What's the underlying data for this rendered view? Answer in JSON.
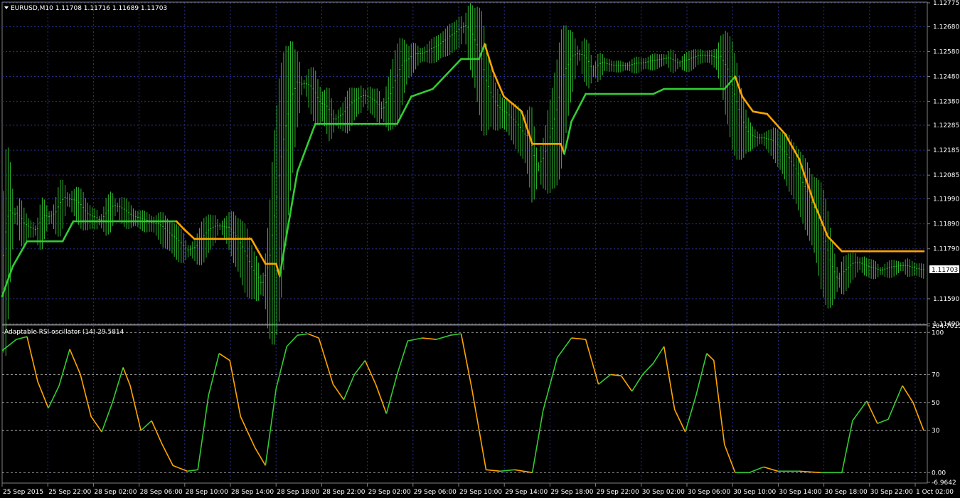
{
  "main_chart": {
    "symbol_info": "EURUSD,M10  1.11708 1.11716 1.11689 1.11703",
    "price_ticks": [
      "1.12775",
      "1.12680",
      "1.12580",
      "1.12480",
      "1.12380",
      "1.12285",
      "1.12185",
      "1.12085",
      "1.11990",
      "1.11890",
      "1.11790",
      "1.11590",
      "1.11490"
    ],
    "current_price": "1.11703",
    "colors": {
      "bars": "#32cd32",
      "ma_up": "#32cd32",
      "ma_down": "#ffa500",
      "grid": "#2a2f8a",
      "price_tag": "#ffffff"
    }
  },
  "oscillator": {
    "title": "Adaptable RSI oscillator (14) 29.5814",
    "levels": [
      "104.7015",
      "100",
      "70",
      "50",
      "30",
      "0.00",
      "-6.9642"
    ],
    "colors": {
      "up": "#32cd32",
      "down": "#ffa500"
    }
  },
  "time_axis": {
    "labels": [
      "25 Sep 2015",
      "25 Sep 22:00",
      "28 Sep 02:00",
      "28 Sep 06:00",
      "28 Sep 10:00",
      "28 Sep 14:00",
      "28 Sep 18:00",
      "28 Sep 22:00",
      "29 Sep 02:00",
      "29 Sep 06:00",
      "29 Sep 10:00",
      "29 Sep 14:00",
      "29 Sep 18:00",
      "29 Sep 22:00",
      "30 Sep 02:00",
      "30 Sep 06:00",
      "30 Sep 10:00",
      "30 Sep 14:00",
      "30 Sep 18:00",
      "30 Sep 22:00",
      "1 Oct 02:00"
    ]
  },
  "chart_data": [
    {
      "type": "line",
      "title": "EURUSD,M10",
      "ylim": [
        1.1149,
        1.12775
      ],
      "series": [
        {
          "name": "price",
          "points": [
            [
              0,
              1.1165
            ],
            [
              10,
              1.1189
            ],
            [
              20,
              1.1193
            ],
            [
              30,
              1.1188
            ],
            [
              50,
              1.1186
            ],
            [
              60,
              1.1191
            ],
            [
              75,
              1.1192
            ],
            [
              90,
              1.1199
            ],
            [
              105,
              1.1197
            ],
            [
              120,
              1.1192
            ],
            [
              140,
              1.119
            ],
            [
              160,
              1.1196
            ],
            [
              180,
              1.1192
            ],
            [
              200,
              1.119
            ],
            [
              220,
              1.1188
            ],
            [
              240,
              1.1183
            ],
            [
              260,
              1.1178
            ],
            [
              275,
              1.1179
            ],
            [
              290,
              1.1185
            ],
            [
              305,
              1.1188
            ],
            [
              320,
              1.1186
            ],
            [
              335,
              1.1179
            ],
            [
              350,
              1.117
            ],
            [
              365,
              1.1164
            ],
            [
              375,
              1.1168
            ],
            [
              385,
              1.1188
            ],
            [
              395,
              1.1213
            ],
            [
              405,
              1.1232
            ],
            [
              415,
              1.1243
            ],
            [
              425,
              1.1245
            ],
            [
              435,
              1.1242
            ],
            [
              445,
              1.1237
            ],
            [
              455,
              1.1235
            ],
            [
              465,
              1.123
            ],
            [
              480,
              1.1232
            ],
            [
              495,
              1.1237
            ],
            [
              510,
              1.124
            ],
            [
              525,
              1.1237
            ],
            [
              535,
              1.1234
            ],
            [
              545,
              1.1238
            ],
            [
              555,
              1.1245
            ],
            [
              565,
              1.1252
            ],
            [
              580,
              1.1256
            ],
            [
              595,
              1.1257
            ],
            [
              610,
              1.1259
            ],
            [
              625,
              1.1262
            ],
            [
              640,
              1.1265
            ],
            [
              650,
              1.1268
            ],
            [
              660,
              1.1263
            ],
            [
              670,
              1.1255
            ],
            [
              680,
              1.1243
            ],
            [
              695,
              1.1235
            ],
            [
              710,
              1.1232
            ],
            [
              725,
              1.1227
            ],
            [
              740,
              1.1221
            ],
            [
              750,
              1.1211
            ],
            [
              760,
              1.1213
            ],
            [
              770,
              1.122
            ],
            [
              780,
              1.123
            ],
            [
              790,
              1.1245
            ],
            [
              800,
              1.1253
            ],
            [
              810,
              1.1257
            ],
            [
              820,
              1.1254
            ],
            [
              830,
              1.125
            ],
            [
              845,
              1.1253
            ],
            [
              860,
              1.1252
            ],
            [
              880,
              1.1252
            ],
            [
              900,
              1.1253
            ],
            [
              920,
              1.1254
            ],
            [
              935,
              1.1255
            ],
            [
              950,
              1.1253
            ],
            [
              965,
              1.1254
            ],
            [
              980,
              1.1256
            ],
            [
              995,
              1.1256
            ],
            [
              1010,
              1.1254
            ],
            [
              1020,
              1.1247
            ],
            [
              1030,
              1.1236
            ],
            [
              1040,
              1.1228
            ],
            [
              1050,
              1.1224
            ],
            [
              1060,
              1.1223
            ],
            [
              1070,
              1.1223
            ],
            [
              1085,
              1.1221
            ],
            [
              1100,
              1.1216
            ],
            [
              1115,
              1.1209
            ],
            [
              1130,
              1.12
            ],
            [
              1145,
              1.119
            ],
            [
              1155,
              1.118
            ],
            [
              1165,
              1.117
            ],
            [
              1175,
              1.1166
            ],
            [
              1185,
              1.1169
            ],
            [
              1195,
              1.1172
            ],
            [
              1205,
              1.1173
            ],
            [
              1220,
              1.1171
            ],
            [
              1235,
              1.117
            ],
            [
              1250,
              1.1171
            ],
            [
              1265,
              1.1172
            ],
            [
              1280,
              1.1171
            ],
            [
              1295,
              1.117
            ]
          ]
        },
        {
          "name": "ma",
          "points": [
            [
              0,
              1.116
            ],
            [
              15,
              1.1172
            ],
            [
              35,
              1.1182
            ],
            [
              85,
              1.1182
            ],
            [
              100,
              1.119
            ],
            [
              245,
              1.119
            ],
            [
              255,
              1.1187
            ],
            [
              270,
              1.1183
            ],
            [
              350,
              1.1183
            ],
            [
              370,
              1.1173
            ],
            [
              385,
              1.1173
            ],
            [
              390,
              1.1168
            ],
            [
              400,
              1.1185
            ],
            [
              415,
              1.121
            ],
            [
              440,
              1.1229
            ],
            [
              555,
              1.1229
            ],
            [
              575,
              1.124
            ],
            [
              605,
              1.1243
            ],
            [
              645,
              1.1255
            ],
            [
              670,
              1.1255
            ],
            [
              678,
              1.1261
            ],
            [
              690,
              1.125
            ],
            [
              705,
              1.124
            ],
            [
              730,
              1.1234
            ],
            [
              745,
              1.1221
            ],
            [
              785,
              1.1221
            ],
            [
              790,
              1.1217
            ],
            [
              800,
              1.123
            ],
            [
              820,
              1.1241
            ],
            [
              915,
              1.1241
            ],
            [
              930,
              1.1243
            ],
            [
              1015,
              1.1243
            ],
            [
              1030,
              1.1248
            ],
            [
              1040,
              1.124
            ],
            [
              1055,
              1.1234
            ],
            [
              1075,
              1.1233
            ],
            [
              1100,
              1.1225
            ],
            [
              1120,
              1.1215
            ],
            [
              1140,
              1.1198
            ],
            [
              1160,
              1.1184
            ],
            [
              1180,
              1.1178
            ],
            [
              1295,
              1.1178
            ]
          ]
        }
      ]
    },
    {
      "type": "line",
      "title": "Adaptable RSI oscillator (14) 29.5814",
      "ylim": [
        -6.9642,
        104.7015
      ],
      "series": [
        {
          "name": "Adaptable RSI oscillator",
          "points": [
            [
              0,
              87
            ],
            [
              20,
              95
            ],
            [
              35,
              97
            ],
            [
              50,
              65
            ],
            [
              65,
              46
            ],
            [
              80,
              62
            ],
            [
              95,
              88
            ],
            [
              110,
              70
            ],
            [
              125,
              40
            ],
            [
              140,
              29
            ],
            [
              155,
              50
            ],
            [
              170,
              75
            ],
            [
              180,
              62
            ],
            [
              195,
              30
            ],
            [
              210,
              37
            ],
            [
              225,
              20
            ],
            [
              240,
              5
            ],
            [
              260,
              1
            ],
            [
              275,
              2
            ],
            [
              290,
              55
            ],
            [
              305,
              85
            ],
            [
              320,
              80
            ],
            [
              335,
              40
            ],
            [
              355,
              18
            ],
            [
              370,
              5
            ],
            [
              385,
              60
            ],
            [
              400,
              90
            ],
            [
              415,
              98
            ],
            [
              430,
              99
            ],
            [
              445,
              96
            ],
            [
              465,
              63
            ],
            [
              480,
              52
            ],
            [
              495,
              70
            ],
            [
              510,
              80
            ],
            [
              525,
              63
            ],
            [
              540,
              42
            ],
            [
              555,
              70
            ],
            [
              570,
              94
            ],
            [
              590,
              96
            ],
            [
              610,
              95
            ],
            [
              630,
              98
            ],
            [
              645,
              99
            ],
            [
              660,
              60
            ],
            [
              680,
              2
            ],
            [
              700,
              1
            ],
            [
              720,
              2
            ],
            [
              745,
              0
            ],
            [
              760,
              44
            ],
            [
              780,
              82
            ],
            [
              800,
              96
            ],
            [
              820,
              95
            ],
            [
              838,
              63
            ],
            [
              855,
              70
            ],
            [
              870,
              69
            ],
            [
              885,
              58
            ],
            [
              900,
              70
            ],
            [
              915,
              78
            ],
            [
              930,
              90
            ],
            [
              945,
              45
            ],
            [
              960,
              29
            ],
            [
              975,
              55
            ],
            [
              990,
              85
            ],
            [
              1000,
              80
            ],
            [
              1015,
              20
            ],
            [
              1030,
              0
            ],
            [
              1050,
              0
            ],
            [
              1070,
              4
            ],
            [
              1090,
              1
            ],
            [
              1120,
              1
            ],
            [
              1150,
              0
            ],
            [
              1180,
              0
            ],
            [
              1195,
              37
            ],
            [
              1215,
              51
            ],
            [
              1230,
              35
            ],
            [
              1245,
              38
            ],
            [
              1265,
              62
            ],
            [
              1280,
              50
            ],
            [
              1295,
              30
            ]
          ]
        }
      ]
    }
  ]
}
